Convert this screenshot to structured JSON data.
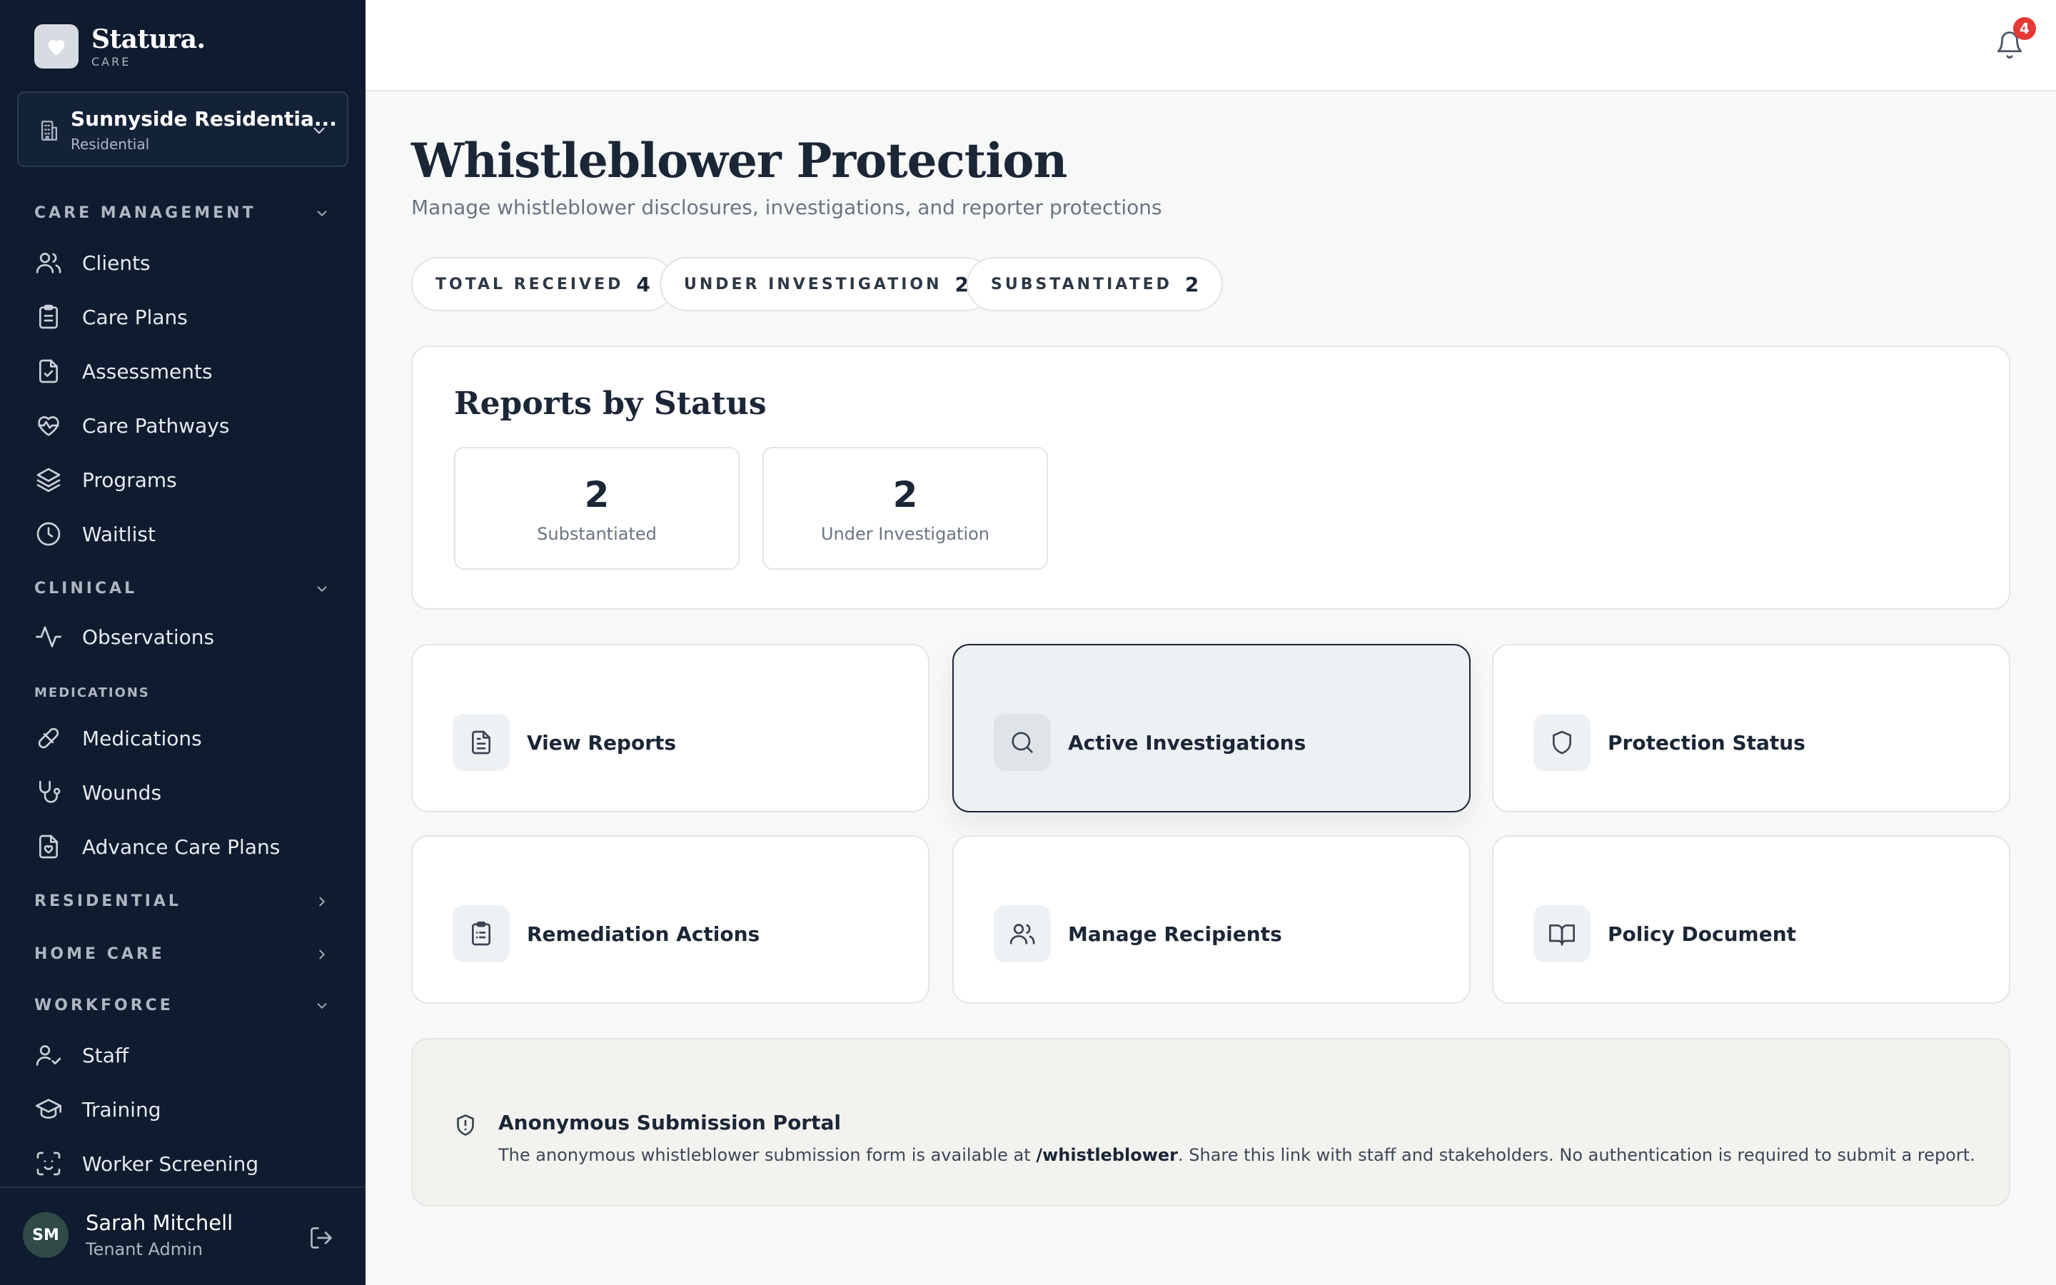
{
  "brand": {
    "name": "Statura.",
    "sub": "CARE"
  },
  "org": {
    "name": "Sunnyside Residentia...",
    "type": "Residential"
  },
  "sidebar": {
    "care_management": "CARE MANAGEMENT",
    "care_items": [
      "Clients",
      "Care Plans",
      "Assessments",
      "Care Pathways",
      "Programs",
      "Waitlist"
    ],
    "clinical": "CLINICAL",
    "clinical_items": [
      "Observations"
    ],
    "medications_head": "MEDICATIONS",
    "medication_items": [
      "Medications",
      "Wounds",
      "Advance Care Plans"
    ],
    "residential": "RESIDENTIAL",
    "home_care": "HOME CARE",
    "workforce": "WORKFORCE",
    "workforce_items": [
      "Staff",
      "Training",
      "Worker Screening"
    ]
  },
  "user": {
    "initials": "SM",
    "name": "Sarah Mitchell",
    "role": "Tenant Admin"
  },
  "notifications": {
    "count": "4"
  },
  "page": {
    "title": "Whistleblower Protection",
    "subtitle": "Manage whistleblower disclosures, investigations, and reporter protections"
  },
  "pills": [
    {
      "label": "TOTAL RECEIVED",
      "value": "4"
    },
    {
      "label": "UNDER INVESTIGATION",
      "value": "2"
    },
    {
      "label": "SUBSTANTIATED",
      "value": "2"
    }
  ],
  "reports_by_status": {
    "title": "Reports by Status",
    "stats": [
      {
        "value": "2",
        "label": "Substantiated"
      },
      {
        "value": "2",
        "label": "Under Investigation"
      }
    ]
  },
  "actions": [
    {
      "label": "View Reports",
      "icon": "file-text-icon"
    },
    {
      "label": "Active Investigations",
      "icon": "search-icon"
    },
    {
      "label": "Protection Status",
      "icon": "shield-icon"
    },
    {
      "label": "Remediation Actions",
      "icon": "clipboard-list-icon"
    },
    {
      "label": "Manage Recipients",
      "icon": "users-icon"
    },
    {
      "label": "Policy Document",
      "icon": "book-open-icon"
    }
  ],
  "portal": {
    "title": "Anonymous Submission Portal",
    "text_before": "The anonymous whistleblower submission form is available at ",
    "path": "/whistleblower",
    "text_after": ". Share this link with staff and stakeholders. No authentication is required to submit a report."
  },
  "colors": {
    "sidebar_bg": "#0f1b2e",
    "accent_badge": "#e53935",
    "text_primary": "#1b2636"
  }
}
